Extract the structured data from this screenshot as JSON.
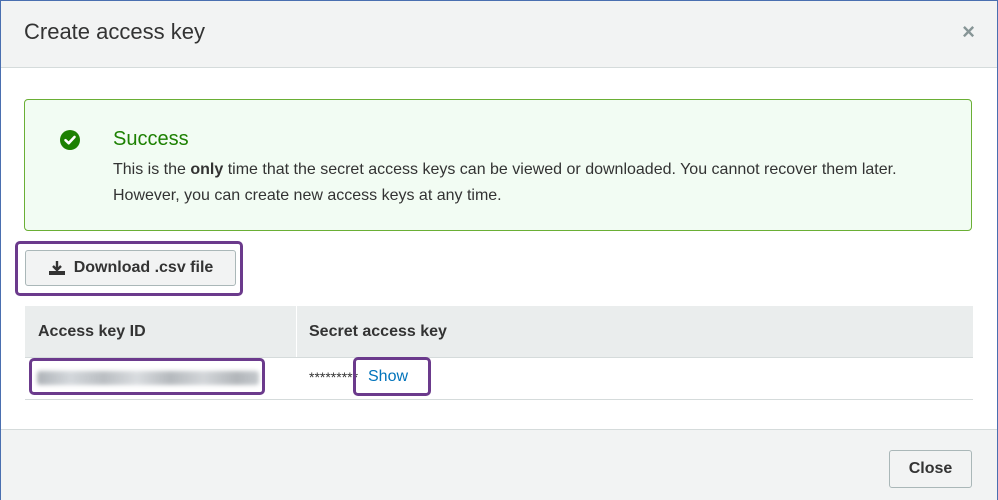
{
  "dialog": {
    "title": "Create access key",
    "close_glyph": "×"
  },
  "alert": {
    "icon": "check-circle-icon",
    "title": "Success",
    "body_part1": "This is the ",
    "body_bold": "only",
    "body_part2": " time that the secret access keys can be viewed or downloaded. You cannot recover them later. However, you can create new access keys at any time."
  },
  "download_button": {
    "icon": "download-icon",
    "label": "Download .csv file"
  },
  "keys_table": {
    "columns": [
      "Access key ID",
      "Secret access key"
    ],
    "rows": [
      {
        "access_key_id": "",
        "secret_masked": "*********",
        "show_label": "Show"
      }
    ]
  },
  "footer": {
    "close_label": "Close"
  },
  "colors": {
    "success_green": "#1d8102",
    "alert_border": "#6aaf35",
    "alert_bg": "#f2fcf3",
    "link_blue": "#0073bb",
    "highlight_purple": "#6b3a8c"
  }
}
